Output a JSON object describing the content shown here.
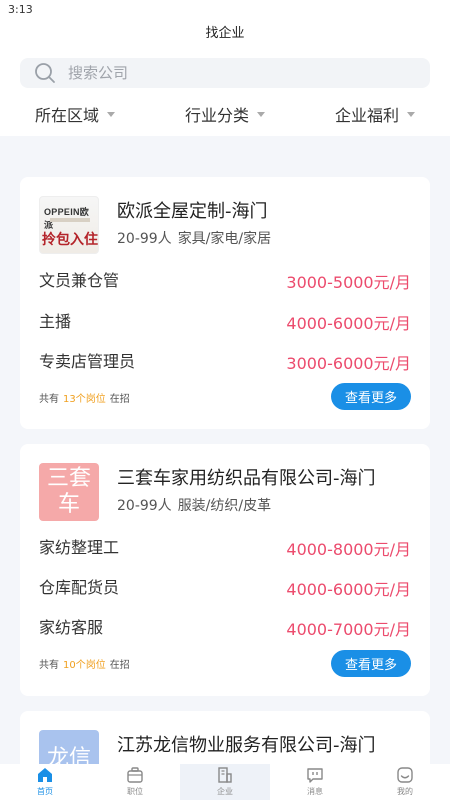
{
  "status_bar": {
    "time": "3:13"
  },
  "header": {
    "title": "找企业"
  },
  "search": {
    "placeholder": "搜索公司"
  },
  "filters": [
    {
      "label": "所在区域"
    },
    {
      "label": "行业分类"
    },
    {
      "label": "企业福利"
    }
  ],
  "companies": [
    {
      "name": "欧派全屋定制-海门",
      "size": "20-99人",
      "category": "家具/家电/家居",
      "logo": {
        "brand": "OPPEIN欧派",
        "slogan": "拎包入住"
      },
      "jobs": [
        {
          "title": "文员兼仓管",
          "salary": "3000-5000元/月"
        },
        {
          "title": "主播",
          "salary": "4000-6000元/月"
        },
        {
          "title": "专卖店管理员",
          "salary": "3000-6000元/月"
        }
      ],
      "summary": {
        "prefix": "共有",
        "count": "13个岗位",
        "suffix": "在招"
      },
      "more_label": "查看更多"
    },
    {
      "name": "三套车家用纺织品有限公司-海门",
      "size": "20-99人",
      "category": "服装/纺织/皮革",
      "logo": {
        "text": "三套车",
        "color": "#f5a9a9"
      },
      "jobs": [
        {
          "title": "家纺整理工",
          "salary": "4000-8000元/月"
        },
        {
          "title": "仓库配货员",
          "salary": "4000-6000元/月"
        },
        {
          "title": "家纺客服",
          "salary": "4000-7000元/月"
        }
      ],
      "summary": {
        "prefix": "共有",
        "count": "10个岗位",
        "suffix": "在招"
      },
      "more_label": "查看更多"
    },
    {
      "name": "江苏龙信物业服务有限公司-海门",
      "logo": {
        "text": "龙信",
        "color": "#a9c3ee"
      }
    }
  ],
  "tabs": [
    {
      "label": "首页"
    },
    {
      "label": "职位"
    },
    {
      "label": "企业"
    },
    {
      "label": "消息"
    },
    {
      "label": "我的"
    }
  ],
  "colors": {
    "accent": "#1a8fe6",
    "salary": "#ec4b6d",
    "count": "#f0a020"
  }
}
